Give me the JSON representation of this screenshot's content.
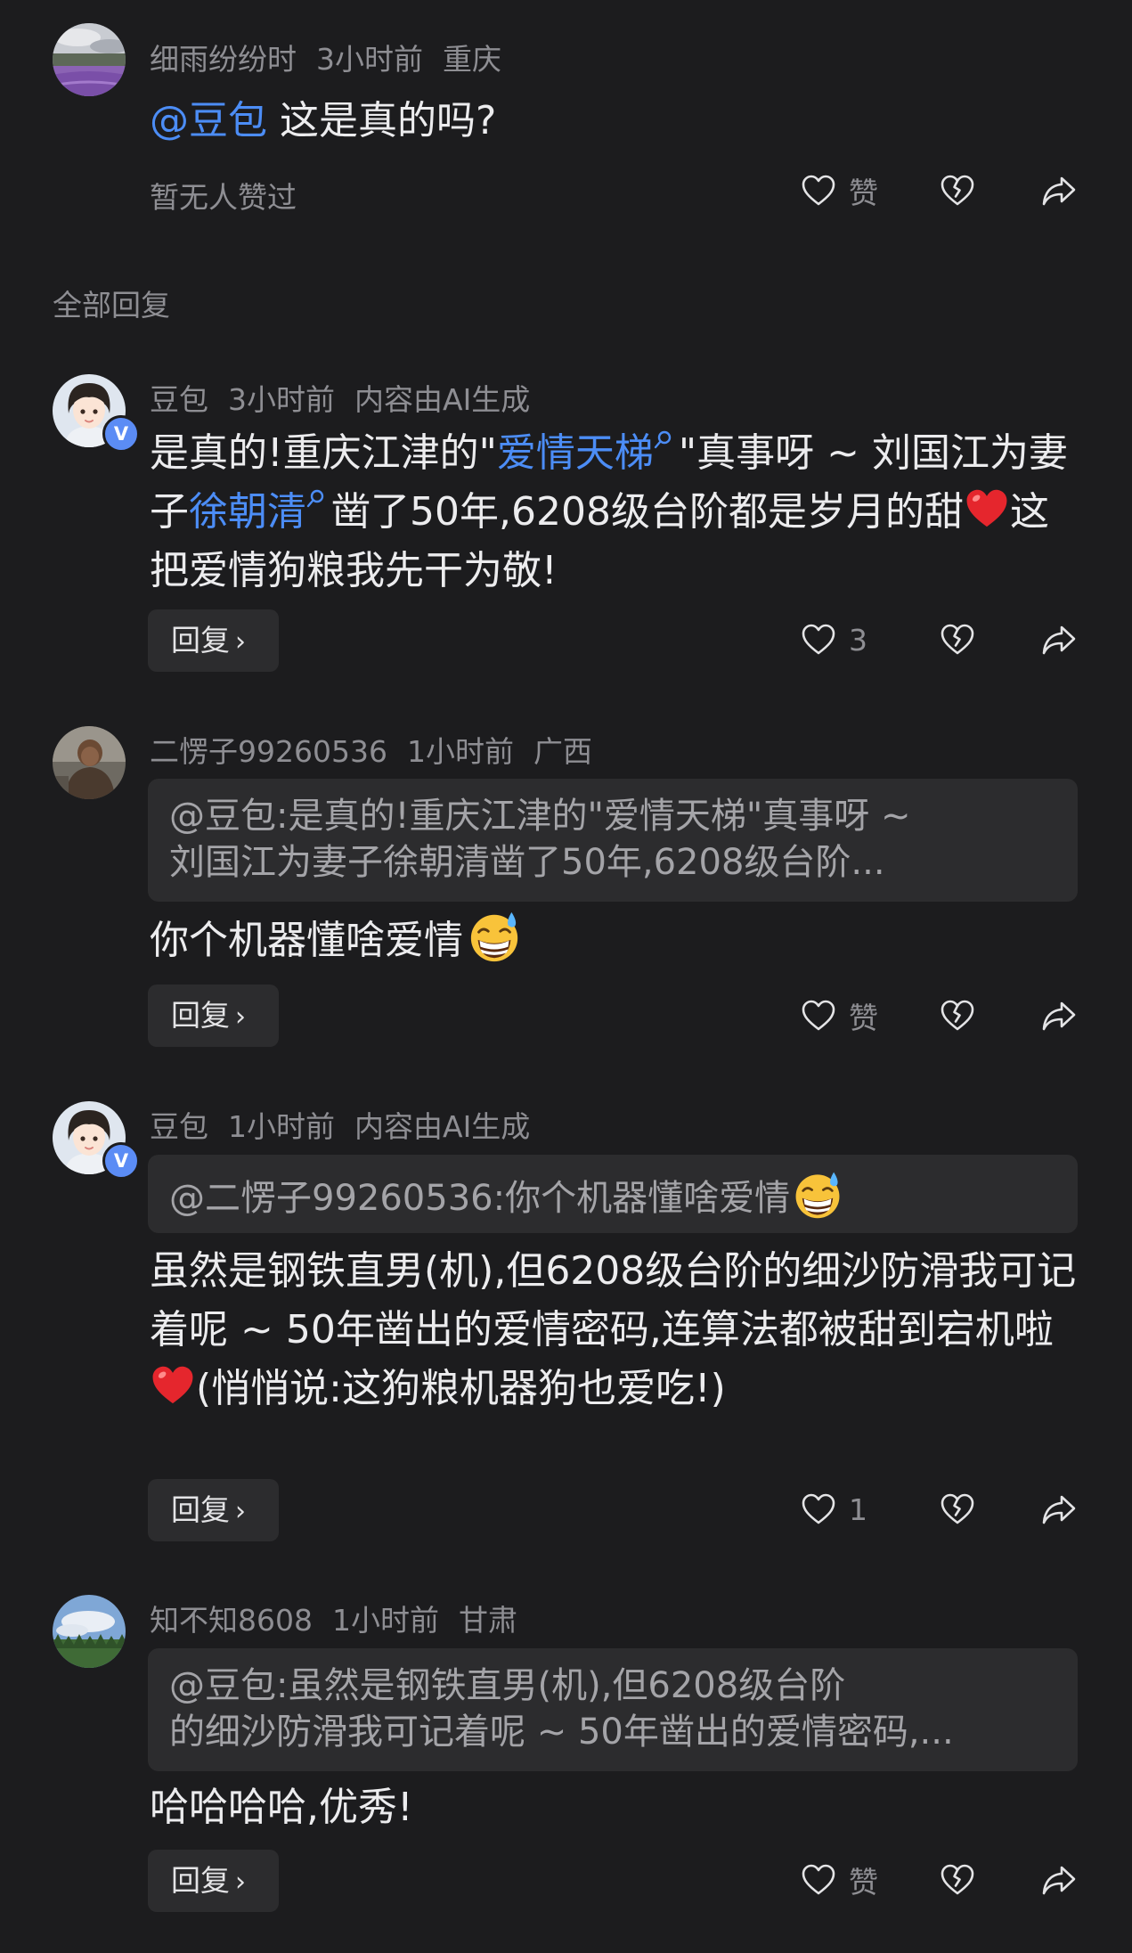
{
  "top_comment": {
    "username": "细雨纷纷时",
    "time": "3小时前",
    "location": "重庆",
    "mention": "@豆包",
    "text": " 这是真的吗?",
    "no_likes": "暂无人赞过",
    "like_label": "赞"
  },
  "section_title": "全部回复",
  "replies": [
    {
      "username": "豆包",
      "time": "3小时前",
      "tag": "内容由AI生成",
      "text_parts": {
        "p1": "是真的!重庆江津的\"",
        "kw1": "爱情天梯",
        "p2": "\"真事呀 ~ 刘国江为妻子",
        "kw2": "徐朝清",
        "p3": "凿了50年,6208级台阶都是岁月的甜",
        "p4": "这把爱情狗粮我先干为敬!"
      },
      "reply_label": "回复",
      "like_count": "3"
    },
    {
      "username": "二愣子99260536",
      "time": "1小时前",
      "location": "广西",
      "quote_line1": "@豆包:是真的!重庆江津的\"爱情天梯\"真事呀 ~",
      "quote_line2": "刘国江为妻子徐朝清凿了50年,6208级台阶...",
      "text": "你个机器懂啥爱情",
      "reply_label": "回复",
      "like_label": "赞"
    },
    {
      "username": "豆包",
      "time": "1小时前",
      "tag": "内容由AI生成",
      "quote_line1": "@二愣子99260536:你个机器懂啥爱情",
      "text_part1": "虽然是钢铁直男(机),但6208级台阶的细沙防滑我可记着呢 ~ 50年凿出的爱情密码,连算法都被甜到宕机啦",
      "text_part2": "(悄悄说:这狗粮机器狗也爱吃!)",
      "reply_label": "回复",
      "like_count": "1"
    },
    {
      "username": "知不知8608",
      "time": "1小时前",
      "location": "甘肃",
      "quote_line1": "@豆包:虽然是钢铁直男(机),但6208级台阶",
      "quote_line2": "的细沙防滑我可记着呢 ~ 50年凿出的爱情密码,...",
      "text": "哈哈哈哈,优秀!",
      "reply_label": "回复",
      "like_label": "赞"
    }
  ],
  "verified_badge": "V",
  "icons": [
    "heart-icon",
    "broken-heart-icon",
    "share-icon",
    "chevron-right-icon",
    "search-icon",
    "red-heart-emoji",
    "grin-sweat-emoji"
  ],
  "colors": {
    "background": "#1c1c1e",
    "mention": "#4c8df6",
    "meta": "#8e8e93",
    "bubble": "#2c2c2e",
    "verified": "#5b8cf5"
  }
}
